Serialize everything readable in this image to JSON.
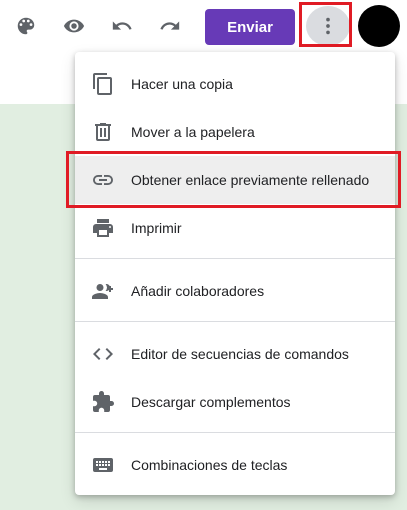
{
  "toolbar": {
    "icons": [
      "palette-icon",
      "eye-icon",
      "undo-icon",
      "redo-icon"
    ],
    "send_label": "Enviar",
    "send_color": "#673ab7",
    "more_icon": "more-vert-icon"
  },
  "menu": {
    "items": [
      {
        "label": "Hacer una copia",
        "icon": "copy-icon"
      },
      {
        "label": "Mover a la papelera",
        "icon": "trash-icon"
      },
      {
        "label": "Obtener enlace previamente rellenado",
        "icon": "link-icon"
      },
      {
        "label": "Imprimir",
        "icon": "print-icon"
      },
      {
        "label": "Añadir colaboradores",
        "icon": "add-people-icon"
      },
      {
        "label": "Editor de secuencias de comandos",
        "icon": "code-icon"
      },
      {
        "label": "Descargar complementos",
        "icon": "puzzle-icon"
      },
      {
        "label": "Combinaciones de teclas",
        "icon": "keyboard-icon"
      }
    ]
  },
  "colors": {
    "background": "#e1eee1",
    "highlight": "#e01b24"
  }
}
